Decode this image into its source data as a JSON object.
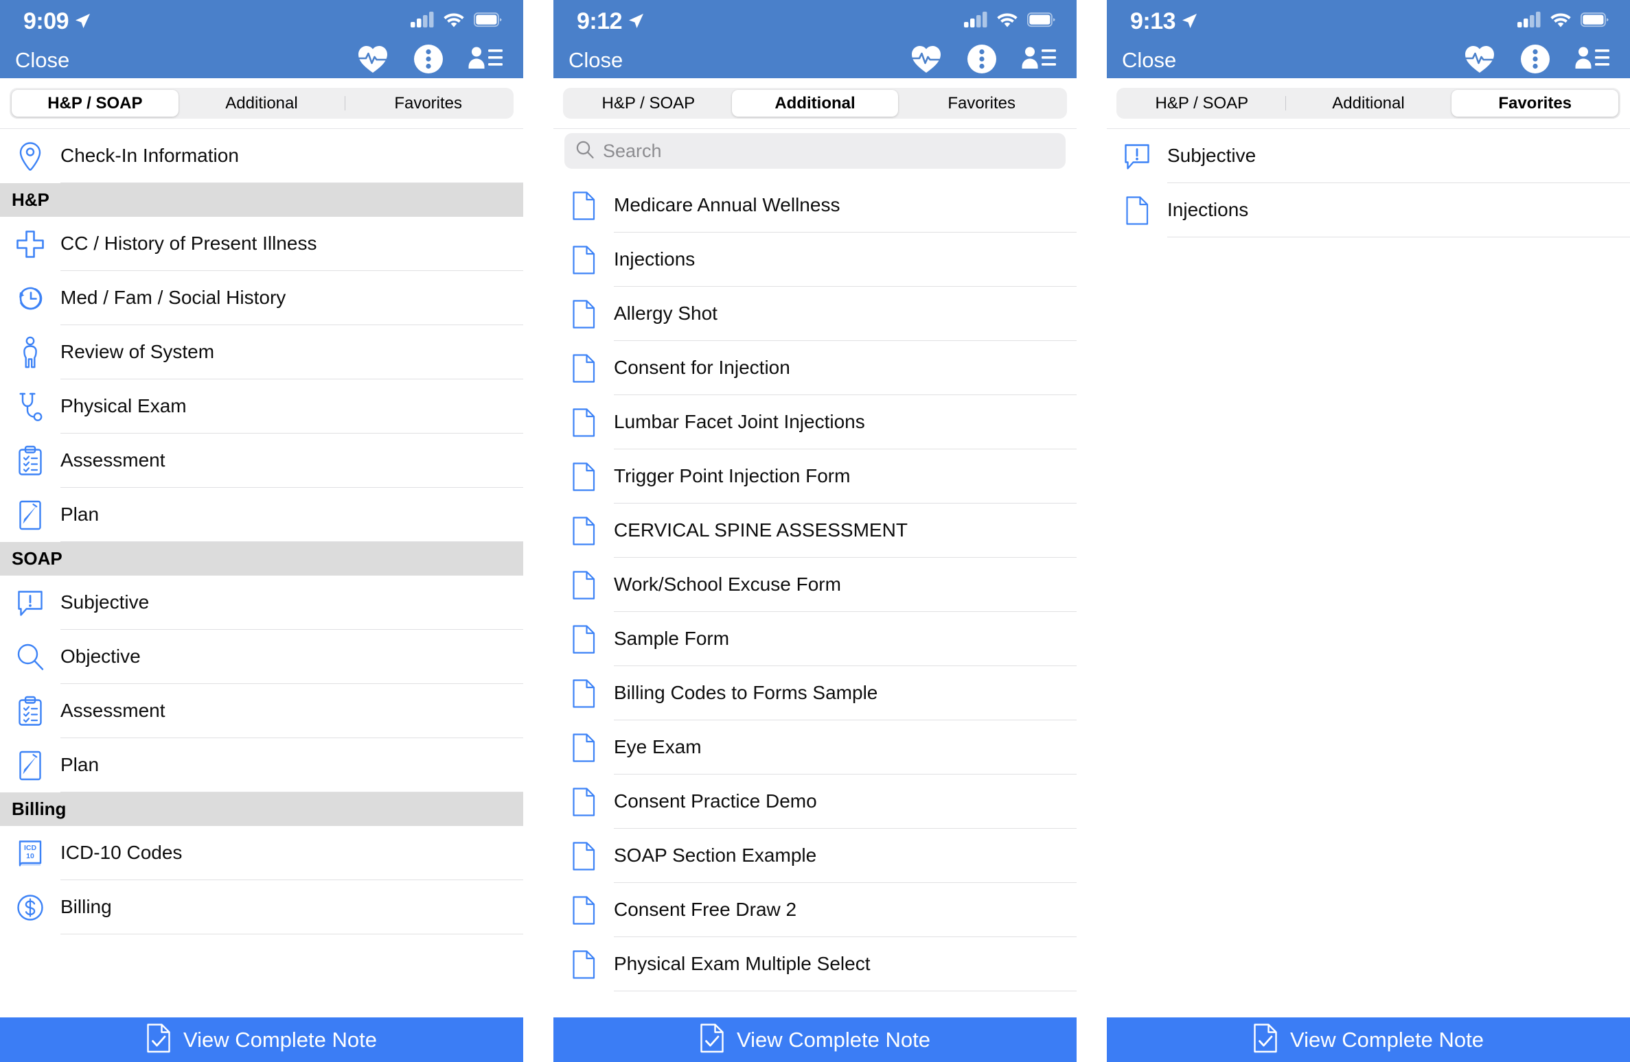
{
  "theme": {
    "header_blue": "#4a80ca",
    "accent_blue": "#3b7df5",
    "icon_blue": "#3c82f6",
    "section_gray": "#dcdcdc",
    "segment_gray": "#efeff0"
  },
  "panels": [
    {
      "status": {
        "time": "9:09",
        "location_icon": "location-arrow-icon"
      },
      "nav": {
        "close_label": "Close",
        "icons": [
          "heart-pulse-icon",
          "overflow-menu-icon",
          "patient-list-icon"
        ]
      },
      "tabs": [
        {
          "label": "H&P / SOAP",
          "active": true
        },
        {
          "label": "Additional",
          "active": false
        },
        {
          "label": "Favorites",
          "active": false
        }
      ],
      "search": null,
      "list": [
        {
          "type": "row",
          "icon": "location-pin-icon",
          "label": "Check-In Information"
        },
        {
          "type": "header",
          "label": "H&P"
        },
        {
          "type": "row",
          "icon": "medical-cross-icon",
          "label": "CC / History of Present Illness"
        },
        {
          "type": "row",
          "icon": "history-clock-icon",
          "label": "Med / Fam / Social History"
        },
        {
          "type": "row",
          "icon": "body-person-icon",
          "label": "Review of System"
        },
        {
          "type": "row",
          "icon": "stethoscope-icon",
          "label": "Physical Exam"
        },
        {
          "type": "row",
          "icon": "clipboard-check-icon",
          "label": "Assessment"
        },
        {
          "type": "row",
          "icon": "pen-note-icon",
          "label": "Plan"
        },
        {
          "type": "header",
          "label": "SOAP"
        },
        {
          "type": "row",
          "icon": "speech-bubble-alert-icon",
          "label": "Subjective"
        },
        {
          "type": "row",
          "icon": "magnifier-icon",
          "label": "Objective"
        },
        {
          "type": "row",
          "icon": "clipboard-check-icon",
          "label": "Assessment"
        },
        {
          "type": "row",
          "icon": "pen-note-icon",
          "label": "Plan"
        },
        {
          "type": "header",
          "label": "Billing"
        },
        {
          "type": "row",
          "icon": "icd10-book-icon",
          "label": "ICD-10 Codes"
        },
        {
          "type": "row",
          "icon": "dollar-circle-icon",
          "label": "Billing"
        }
      ],
      "bottom": {
        "icon": "document-check-icon",
        "label": "View Complete Note"
      }
    },
    {
      "status": {
        "time": "9:12",
        "location_icon": "location-arrow-icon"
      },
      "nav": {
        "close_label": "Close",
        "icons": [
          "heart-pulse-icon",
          "overflow-menu-icon",
          "patient-list-icon"
        ]
      },
      "tabs": [
        {
          "label": "H&P / SOAP",
          "active": false
        },
        {
          "label": "Additional",
          "active": true
        },
        {
          "label": "Favorites",
          "active": false
        }
      ],
      "search": {
        "placeholder": "Search",
        "value": "",
        "icon": "search-icon"
      },
      "list": [
        {
          "type": "row",
          "icon": "document-icon",
          "label": "Medicare Annual Wellness"
        },
        {
          "type": "row",
          "icon": "document-icon",
          "label": "Injections"
        },
        {
          "type": "row",
          "icon": "document-icon",
          "label": "Allergy Shot"
        },
        {
          "type": "row",
          "icon": "document-icon",
          "label": "Consent for Injection"
        },
        {
          "type": "row",
          "icon": "document-icon",
          "label": "Lumbar Facet Joint Injections"
        },
        {
          "type": "row",
          "icon": "document-icon",
          "label": "Trigger Point Injection Form"
        },
        {
          "type": "row",
          "icon": "document-icon",
          "label": "CERVICAL SPINE ASSESSMENT"
        },
        {
          "type": "row",
          "icon": "document-icon",
          "label": "Work/School Excuse Form"
        },
        {
          "type": "row",
          "icon": "document-icon",
          "label": "Sample Form"
        },
        {
          "type": "row",
          "icon": "document-icon",
          "label": "Billing Codes to Forms Sample"
        },
        {
          "type": "row",
          "icon": "document-icon",
          "label": "Eye Exam"
        },
        {
          "type": "row",
          "icon": "document-icon",
          "label": "Consent Practice Demo"
        },
        {
          "type": "row",
          "icon": "document-icon",
          "label": "SOAP Section Example"
        },
        {
          "type": "row",
          "icon": "document-icon",
          "label": "Consent Free Draw 2"
        },
        {
          "type": "row",
          "icon": "document-icon",
          "label": "Physical Exam Multiple Select"
        }
      ],
      "bottom": {
        "icon": "document-check-icon",
        "label": "View Complete Note"
      }
    },
    {
      "status": {
        "time": "9:13",
        "location_icon": "location-arrow-icon"
      },
      "nav": {
        "close_label": "Close",
        "icons": [
          "heart-pulse-icon",
          "overflow-menu-icon",
          "patient-list-icon"
        ]
      },
      "tabs": [
        {
          "label": "H&P / SOAP",
          "active": false
        },
        {
          "label": "Additional",
          "active": false
        },
        {
          "label": "Favorites",
          "active": true
        }
      ],
      "search": null,
      "list": [
        {
          "type": "row",
          "icon": "speech-bubble-alert-icon",
          "label": "Subjective"
        },
        {
          "type": "row",
          "icon": "document-icon",
          "label": "Injections"
        }
      ],
      "bottom": {
        "icon": "document-check-icon",
        "label": "View Complete Note"
      }
    }
  ]
}
